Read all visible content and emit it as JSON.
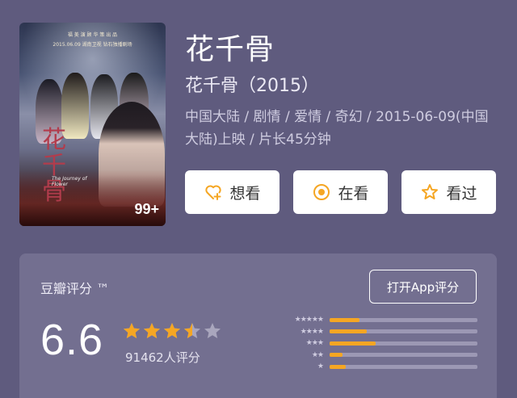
{
  "poster": {
    "tagline": "福 美 演 顾   华 策 出 品",
    "date_line": "2015.06.09 湖南卫视 钻石独播剧场",
    "calligraphy": "花千骨",
    "english_title": "The Journey of Flower",
    "photo_count": "99+"
  },
  "movie": {
    "title": "花千骨",
    "original_title": "花千骨（2015）",
    "meta": "中国大陆 / 剧情 / 爱情 / 奇幻 / 2015-06-09(中国大陆)上映 / 片长45分钟"
  },
  "actions": {
    "want_label": "想看",
    "watching_label": "在看",
    "watched_label": "看过"
  },
  "rating": {
    "label": "豆瓣评分 ™",
    "open_app_label": "打开App评分",
    "score": "6.6",
    "count_text": "91462人评分",
    "stars_value": 3.5,
    "distribution": [
      {
        "stars": "★★★★★",
        "fraction": 0.2
      },
      {
        "stars": "★★★★",
        "fraction": 0.25
      },
      {
        "stars": "★★★",
        "fraction": 0.31
      },
      {
        "stars": "★★",
        "fraction": 0.09
      },
      {
        "stars": "★",
        "fraction": 0.11
      }
    ]
  },
  "colors": {
    "background": "#5f5b7e",
    "panel": "#736f90",
    "accent": "#f5a623",
    "button_bg": "#ffffff"
  }
}
